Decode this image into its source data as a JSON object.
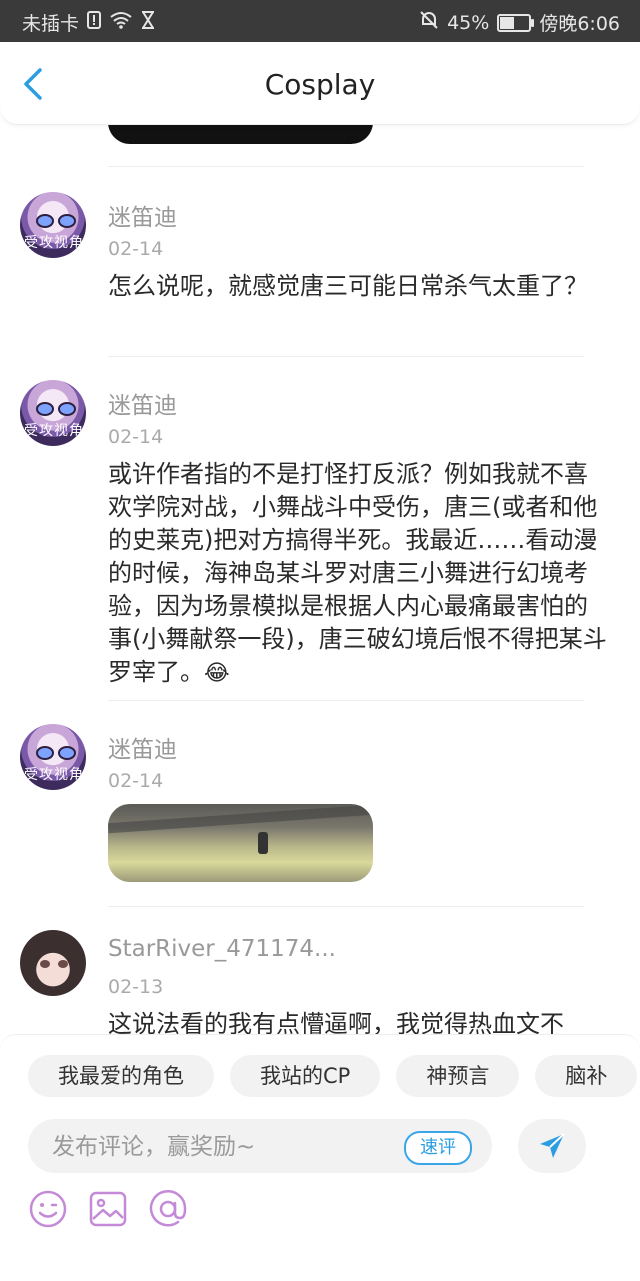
{
  "status_bar": {
    "carrier": "未插卡",
    "battery": "45%",
    "time": "傍晚6:06"
  },
  "header": {
    "title": "Cosplay"
  },
  "comments": [
    {
      "user": "迷笛迪",
      "date": "02-14",
      "text": "怎么说呢，就感觉唐三可能日常杀气太重了？",
      "avatar_label": "受攻视角"
    },
    {
      "user": "迷笛迪",
      "date": "02-14",
      "text": "或许作者指的不是打怪打反派？例如我就不喜欢学院对战，小舞战斗中受伤，唐三(或者和他的史莱克)把对方搞得半死。我最近……看动漫的时候，海神岛某斗罗对唐三小舞进行幻境考验，因为场景模拟是根据人内心最痛最害怕的事(小舞献祭一段)，唐三破幻境后恨不得把某斗罗宰了。",
      "emoji": "😂",
      "avatar_label": "受攻视角"
    },
    {
      "user": "迷笛迪",
      "date": "02-14",
      "image": "game-scene-thumbnail",
      "avatar_label": "受攻视角"
    },
    {
      "user": "StarRiver_471174...",
      "date": "02-13",
      "text": "这说法看的我有点懵逼啊，我觉得热血文不"
    }
  ],
  "composer": {
    "tags": [
      "我最爱的角色",
      "我站的CP",
      "神预言",
      "脑补"
    ],
    "placeholder": "发布评论，赢奖励~",
    "quick_review": "速评",
    "tools": [
      "emoji-icon",
      "image-icon",
      "mention-icon"
    ]
  },
  "colors": {
    "accent": "#2c9de3",
    "status_bar": "#3a3a3a",
    "tool_icon": "#c48ad8"
  }
}
